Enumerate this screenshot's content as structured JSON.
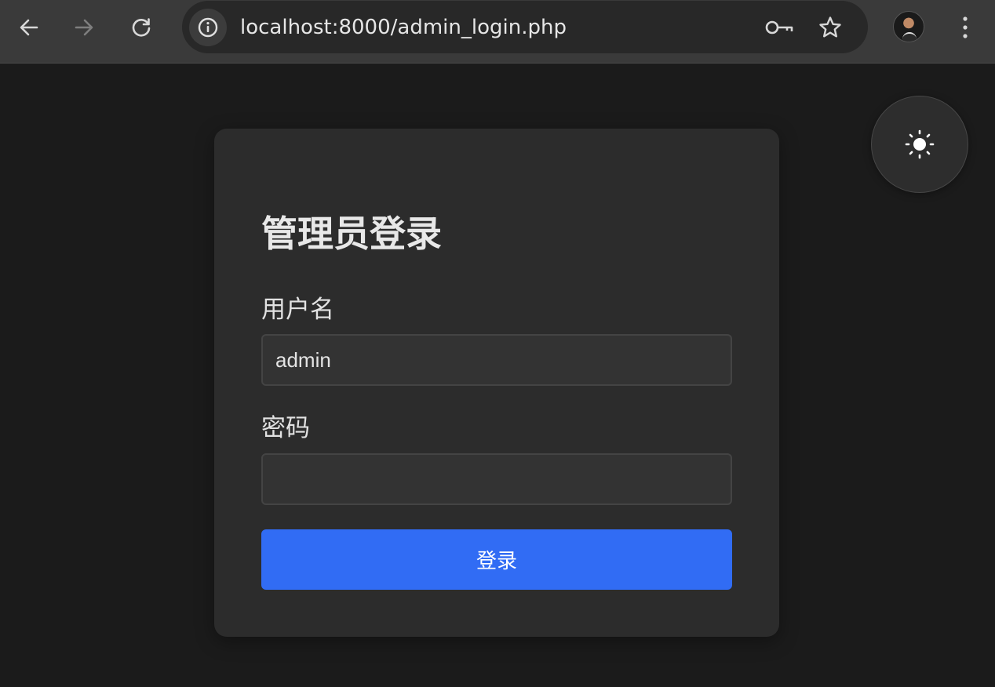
{
  "browser": {
    "url": "localhost:8000/admin_login.php",
    "icons": {
      "back": "arrow-left-icon",
      "forward": "arrow-right-icon",
      "reload": "reload-icon",
      "site_info": "info-icon",
      "password_key": "key-icon",
      "bookmark": "star-icon",
      "profile": "avatar",
      "menu": "kebab-menu-icon"
    }
  },
  "theme_toggle": {
    "icon": "sun-icon"
  },
  "login": {
    "title": "管理员登录",
    "username_label": "用户名",
    "username_value": "admin",
    "username_placeholder": "",
    "password_label": "密码",
    "password_value": "",
    "password_placeholder": "",
    "submit_label": "登录"
  },
  "colors": {
    "page_background": "#1b1b1b",
    "card_background": "#2c2c2c",
    "input_background": "#333333",
    "primary_button": "#316cf4",
    "toolbar": "#3a3a3a"
  }
}
